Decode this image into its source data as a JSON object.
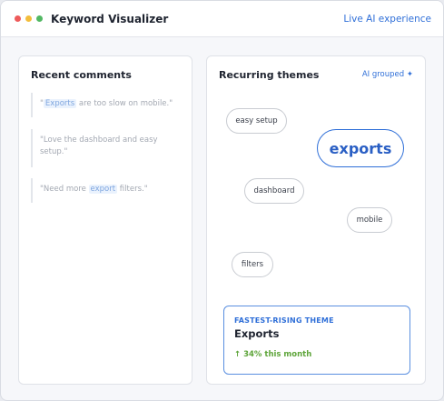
{
  "app": {
    "title": "Keyword Visualizer",
    "live_link": "Live AI experience"
  },
  "comments_panel": {
    "title": "Recent comments",
    "comments": [
      {
        "prefix": "\"",
        "keyword": "Exports",
        "suffix": " are too slow on mobile.\""
      },
      {
        "text": "\"Love the dashboard and easy setup.\""
      },
      {
        "prefix": "\"Need more ",
        "keyword": "export",
        "suffix": " filters.\""
      }
    ]
  },
  "themes_panel": {
    "title": "Recurring themes",
    "ai_grouped": "AI grouped ✦",
    "themes": [
      {
        "label": "easy setup"
      },
      {
        "label": "exports"
      },
      {
        "label": "dashboard"
      },
      {
        "label": "mobile"
      },
      {
        "label": "filters"
      }
    ]
  },
  "fastest_rising": {
    "label": "FASTEST-RISING THEME",
    "name": "Exports",
    "change": "↑ 34% this month",
    "change_color": "#5ea53a"
  },
  "colors": {
    "accent": "#2f6fd8",
    "traffic_red": "#ee5b5b",
    "traffic_yellow": "#f3bd3c",
    "traffic_green": "#52b863"
  }
}
